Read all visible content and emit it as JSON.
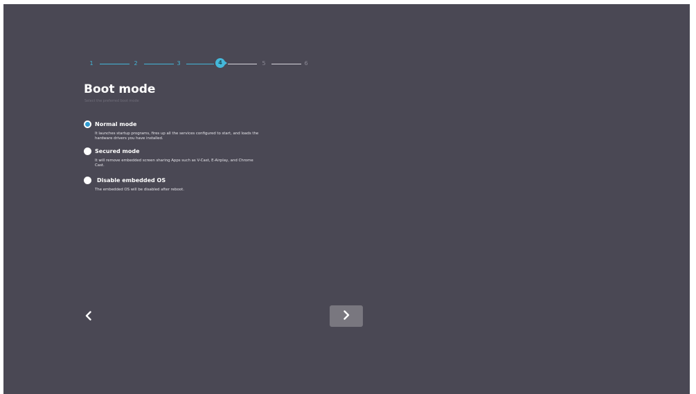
{
  "stepper": {
    "steps": [
      "1",
      "2",
      "3",
      "4",
      "5",
      "6"
    ],
    "current_step": 4,
    "colors": {
      "active": "#44b8da",
      "inactive": "#8c8a96"
    }
  },
  "page": {
    "title": "Boot mode",
    "subtitle": "Select the preferred boot mode"
  },
  "options": [
    {
      "label": "Normal mode",
      "description": "It launches startup programs, fires up all the services configured to start, and loads the hardware drivers you have installed.",
      "selected": true
    },
    {
      "label": "Secured mode",
      "description": "It will remove embedded screen sharing Apps such as V-Cast, E-Airplay, and Chrome Cast.",
      "selected": false
    },
    {
      "label": "Disable embedded OS",
      "description": "The embedded OS will be disabled after reboot.",
      "selected": false
    }
  ],
  "navigation": {
    "back_icon": "chevron-left-icon",
    "next_icon": "chevron-right-icon"
  },
  "colors": {
    "background": "#4a4854",
    "accent": "#44b8da",
    "radio_selected": "#2f9bd1",
    "next_button": "#79777f"
  }
}
